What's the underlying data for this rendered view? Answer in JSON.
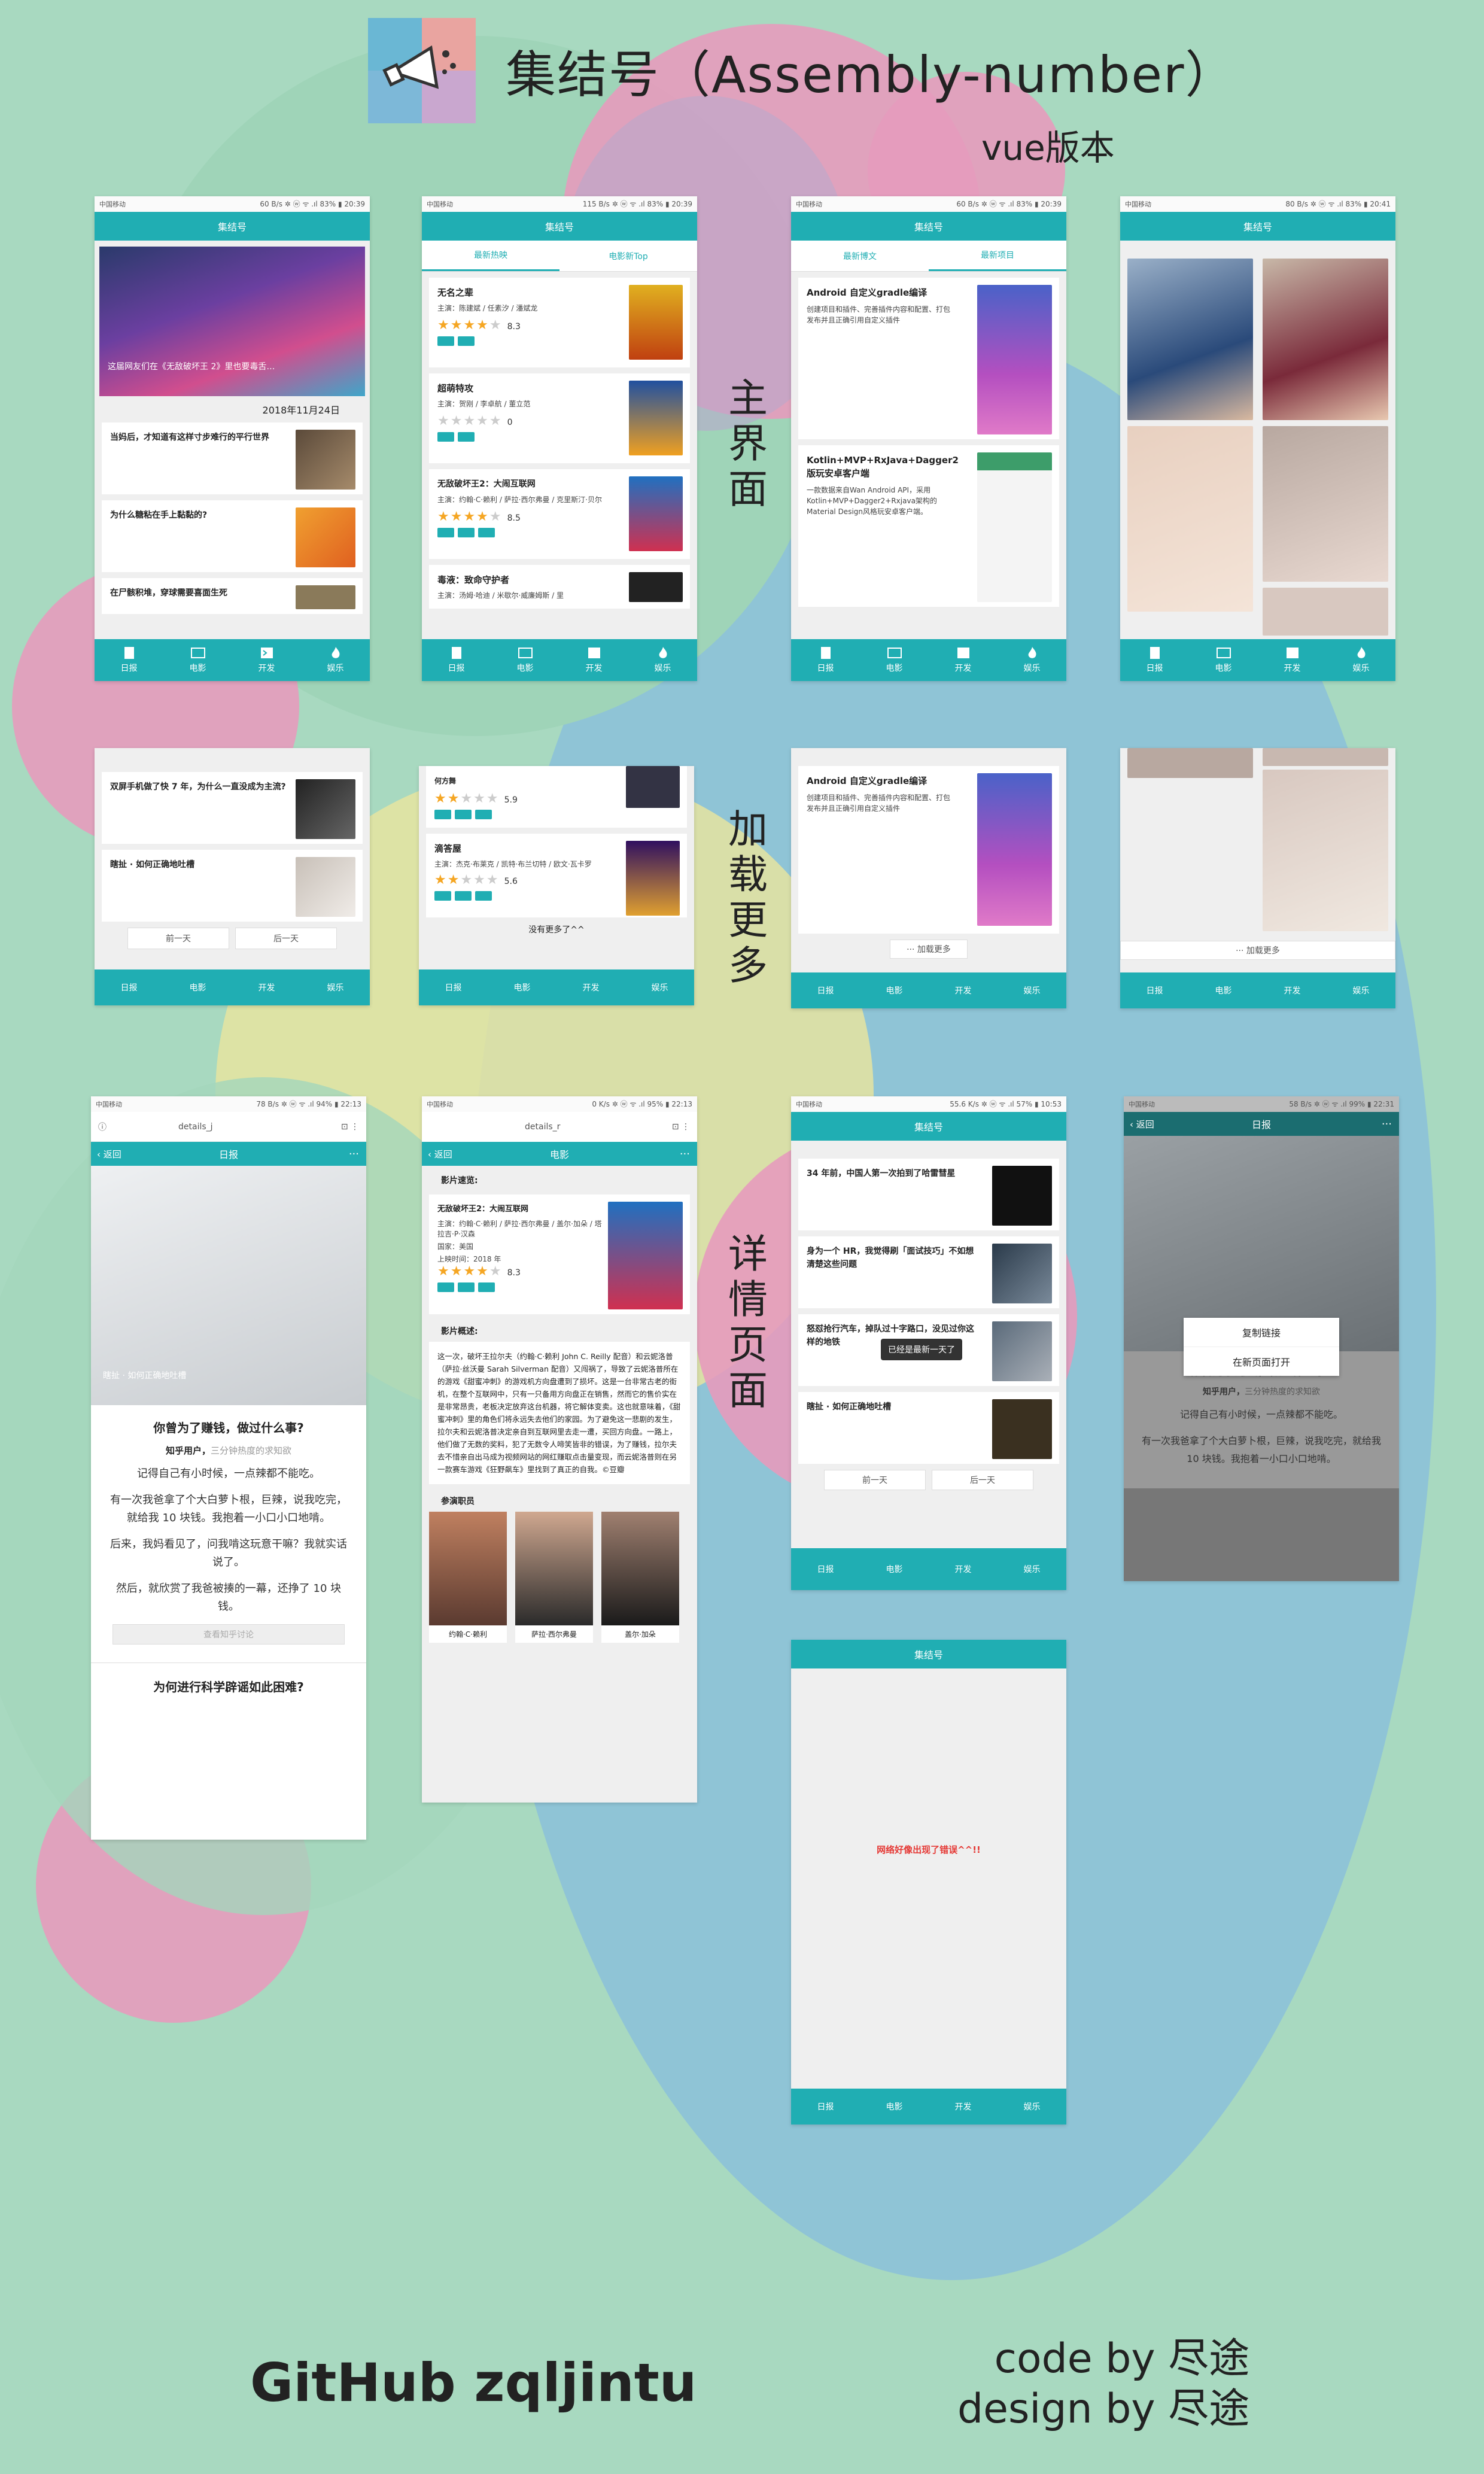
{
  "header": {
    "title": "集结号（Assembly-number）",
    "subtitle": "vue版本"
  },
  "sections": {
    "main": "主界面",
    "loadmore": "加载更多",
    "detail": "详情页面"
  },
  "status": {
    "carrier1": "中国移动",
    "carrier2": "中国移动",
    "s1": "60 B/s ✲ ⓦ ᯤ .ıl 83% ▮ 20:39",
    "s2": "115 B/s ✲ ⓦ ᯤ .ıl 83% ▮ 20:39",
    "s3": "60 B/s ✲ ⓦ ᯤ .ıl 83% ▮ 20:39",
    "s4": "80 B/s ✲ ⓦ ᯤ .ıl 83% ▮ 20:41",
    "s9": "78 B/s ✲ ⓦ ᯤ .ıl 94% ▮ 22:13",
    "s10": "0 K/s ✲ ⓦ ᯤ .ıl 95% ▮ 22:13",
    "s11": "55.6 K/s ✲ ⓦ ᯤ .ıl 57% ▮ 10:53",
    "s12": "58 B/s ✲ ⓦ ᯤ .ıl 99% ▮ 22:31"
  },
  "app": {
    "title": "集结号",
    "tab_bar": [
      "日报",
      "电影",
      "开发",
      "娱乐"
    ],
    "movie_tabs": [
      "最新热映",
      "电影新Top"
    ],
    "dev_tabs": [
      "最新博文",
      "最新项目"
    ],
    "back": "返回",
    "more": "···"
  },
  "daily": {
    "banner_text": "这届网友们在《无敌破坏王 2》里也要毒舌…",
    "date": "2018年11月24日",
    "items": [
      "当妈后，才知道有这样寸步难行的平行世界",
      "为什么糖粘在手上黏黏的?",
      "在尸骸积堆，穿球需要喜面生死"
    ],
    "more_items": [
      "双屏手机做了快 7 年，为什么一直没成为主流?",
      "瞎扯 · 如何正确地吐槽"
    ],
    "prev": "前一天",
    "next": "后一天"
  },
  "movies": {
    "items": [
      {
        "title": "无名之辈",
        "cast": "主演：陈建斌 / 任素汐 / 潘斌龙",
        "rating": "8.3"
      },
      {
        "title": "超萌特攻",
        "cast": "主演：贺刚 / 李卓航 / 董立范",
        "rating": "0"
      },
      {
        "title": "无敌破坏王2：大闹互联网",
        "cast": "主演：约翰·C·赖利 / 萨拉·西尔弗曼 / 克里斯汀·贝尔",
        "rating": "8.5"
      },
      {
        "title": "毒液：致命守护者",
        "cast": "主演：汤姆·哈迪 / 米歇尔·威廉姆斯 / 里",
        "rating": ""
      }
    ],
    "more_items": [
      {
        "title": "何方舞",
        "rating": "5.9"
      },
      {
        "title": "滴答屋",
        "cast": "主演：杰克·布莱克 / 凯特·布兰切特 / 欧文·瓦卡罗",
        "rating": "5.6"
      }
    ],
    "no_more": "没有更多了^^"
  },
  "dev": {
    "items": [
      {
        "title": "Android 自定义gradle编译",
        "desc": "创建项目和插件、完善插件内容和配置、打包发布并且正确引用自定义插件"
      },
      {
        "title": "Kotlin+MVP+RxJava+Dagger2版玩安卓客户端",
        "desc": "一款数据来自Wan Android API，采用Kotlin+MVP+Dagger2+Rxjava架构的Material Design风格玩安卓客户端。"
      }
    ],
    "load_more": "··· 加载更多"
  },
  "detail_daily": {
    "url": "details_j",
    "page_title": "日报",
    "image_caption": "瞎扯 · 如何正确地吐槽",
    "question": "你曾为了赚钱，做过什么事?",
    "author": "知乎用户，",
    "author_desc": "三分钟热度的求知欲",
    "paragraphs": [
      "记得自己有小时候，一点辣都不能吃。",
      "有一次我爸拿了个大白萝卜根，巨辣，说我吃完，就给我 10 块钱。我抱着一小口小口地啃。",
      "后来，我妈看见了，问我啃这玩意干嘛？我就实话说了。",
      "然后，就欣赏了我爸被揍的一幕，还挣了 10 块钱。"
    ],
    "zhihu_link": "查看知乎讨论",
    "next_question": "为何进行科学辟谣如此困难?"
  },
  "detail_movie": {
    "url": "details_r",
    "page_title": "电影",
    "brief_label": "影片速览:",
    "title": "无敌破坏王2：大闹互联网",
    "cast": "主演：约翰·C·赖利 / 萨拉·西尔弗曼 / 盖尔·加朵 / 塔拉吉·P·汉森",
    "country": "国家：美国",
    "release": "上映时间：2018 年",
    "rating": "8.3",
    "summary_label": "影片概述:",
    "summary": "这一次，破坏王拉尔夫（约翰·C·赖利 John C. Reilly 配音）和云妮洛普（萨拉·丝沃曼 Sarah Silverman 配音）又闯祸了，导致了云妮洛普所在的游戏《甜蜜冲刺》的游戏机方向盘遭到了损坏。这是一台非常古老的街机，在整个互联网中，只有一只备用方向盘正在销售，然而它的售价实在是非常昂贵，老板决定放弃这台机器，将它解体变卖。这也就意味着，《甜蜜冲刺》里的角色们将永远失去他们的家园。为了避免这一悲剧的发生，拉尔夫和云妮洛普决定亲自到互联网里去走一遭，买回方向盘。一路上，他们做了无数的奖料，犯了无数令人啼笑皆非的错误，为了赚钱，拉尔夫去不惜亲自出马成为视频网站的网红赚取点击量变现，而云妮洛普则在另一款赛车游戏《狂野飙车》里找到了真正的自我。©豆瓣",
    "cast_label": "参演职员",
    "actors": [
      "约翰·C·赖利",
      "萨拉·西尔弗曼",
      "盖尔·加朵"
    ]
  },
  "refresh": {
    "items": [
      "34 年前，中国人第一次拍到了哈雷彗星",
      "身为一个 HR，我觉得刷「面试技巧」不如想清楚这些问题",
      "怒怼抢行汽车，掉队过十字路口，没见过你这样的地铁",
      "瞎扯 · 如何正确地吐槽"
    ],
    "toast": "已经是最新一天了"
  },
  "menu": {
    "copy": "复制链接",
    "open": "在新页面打开"
  },
  "error": {
    "text": "网络好像出现了错误^^!!"
  },
  "footer": {
    "github": "GitHub zqljintu",
    "code_by": "code by 尽途",
    "design_by": "design by 尽途"
  },
  "colors": {
    "accent": "#20aeb3",
    "background": "#a8d9c0",
    "error": "#e53935"
  }
}
